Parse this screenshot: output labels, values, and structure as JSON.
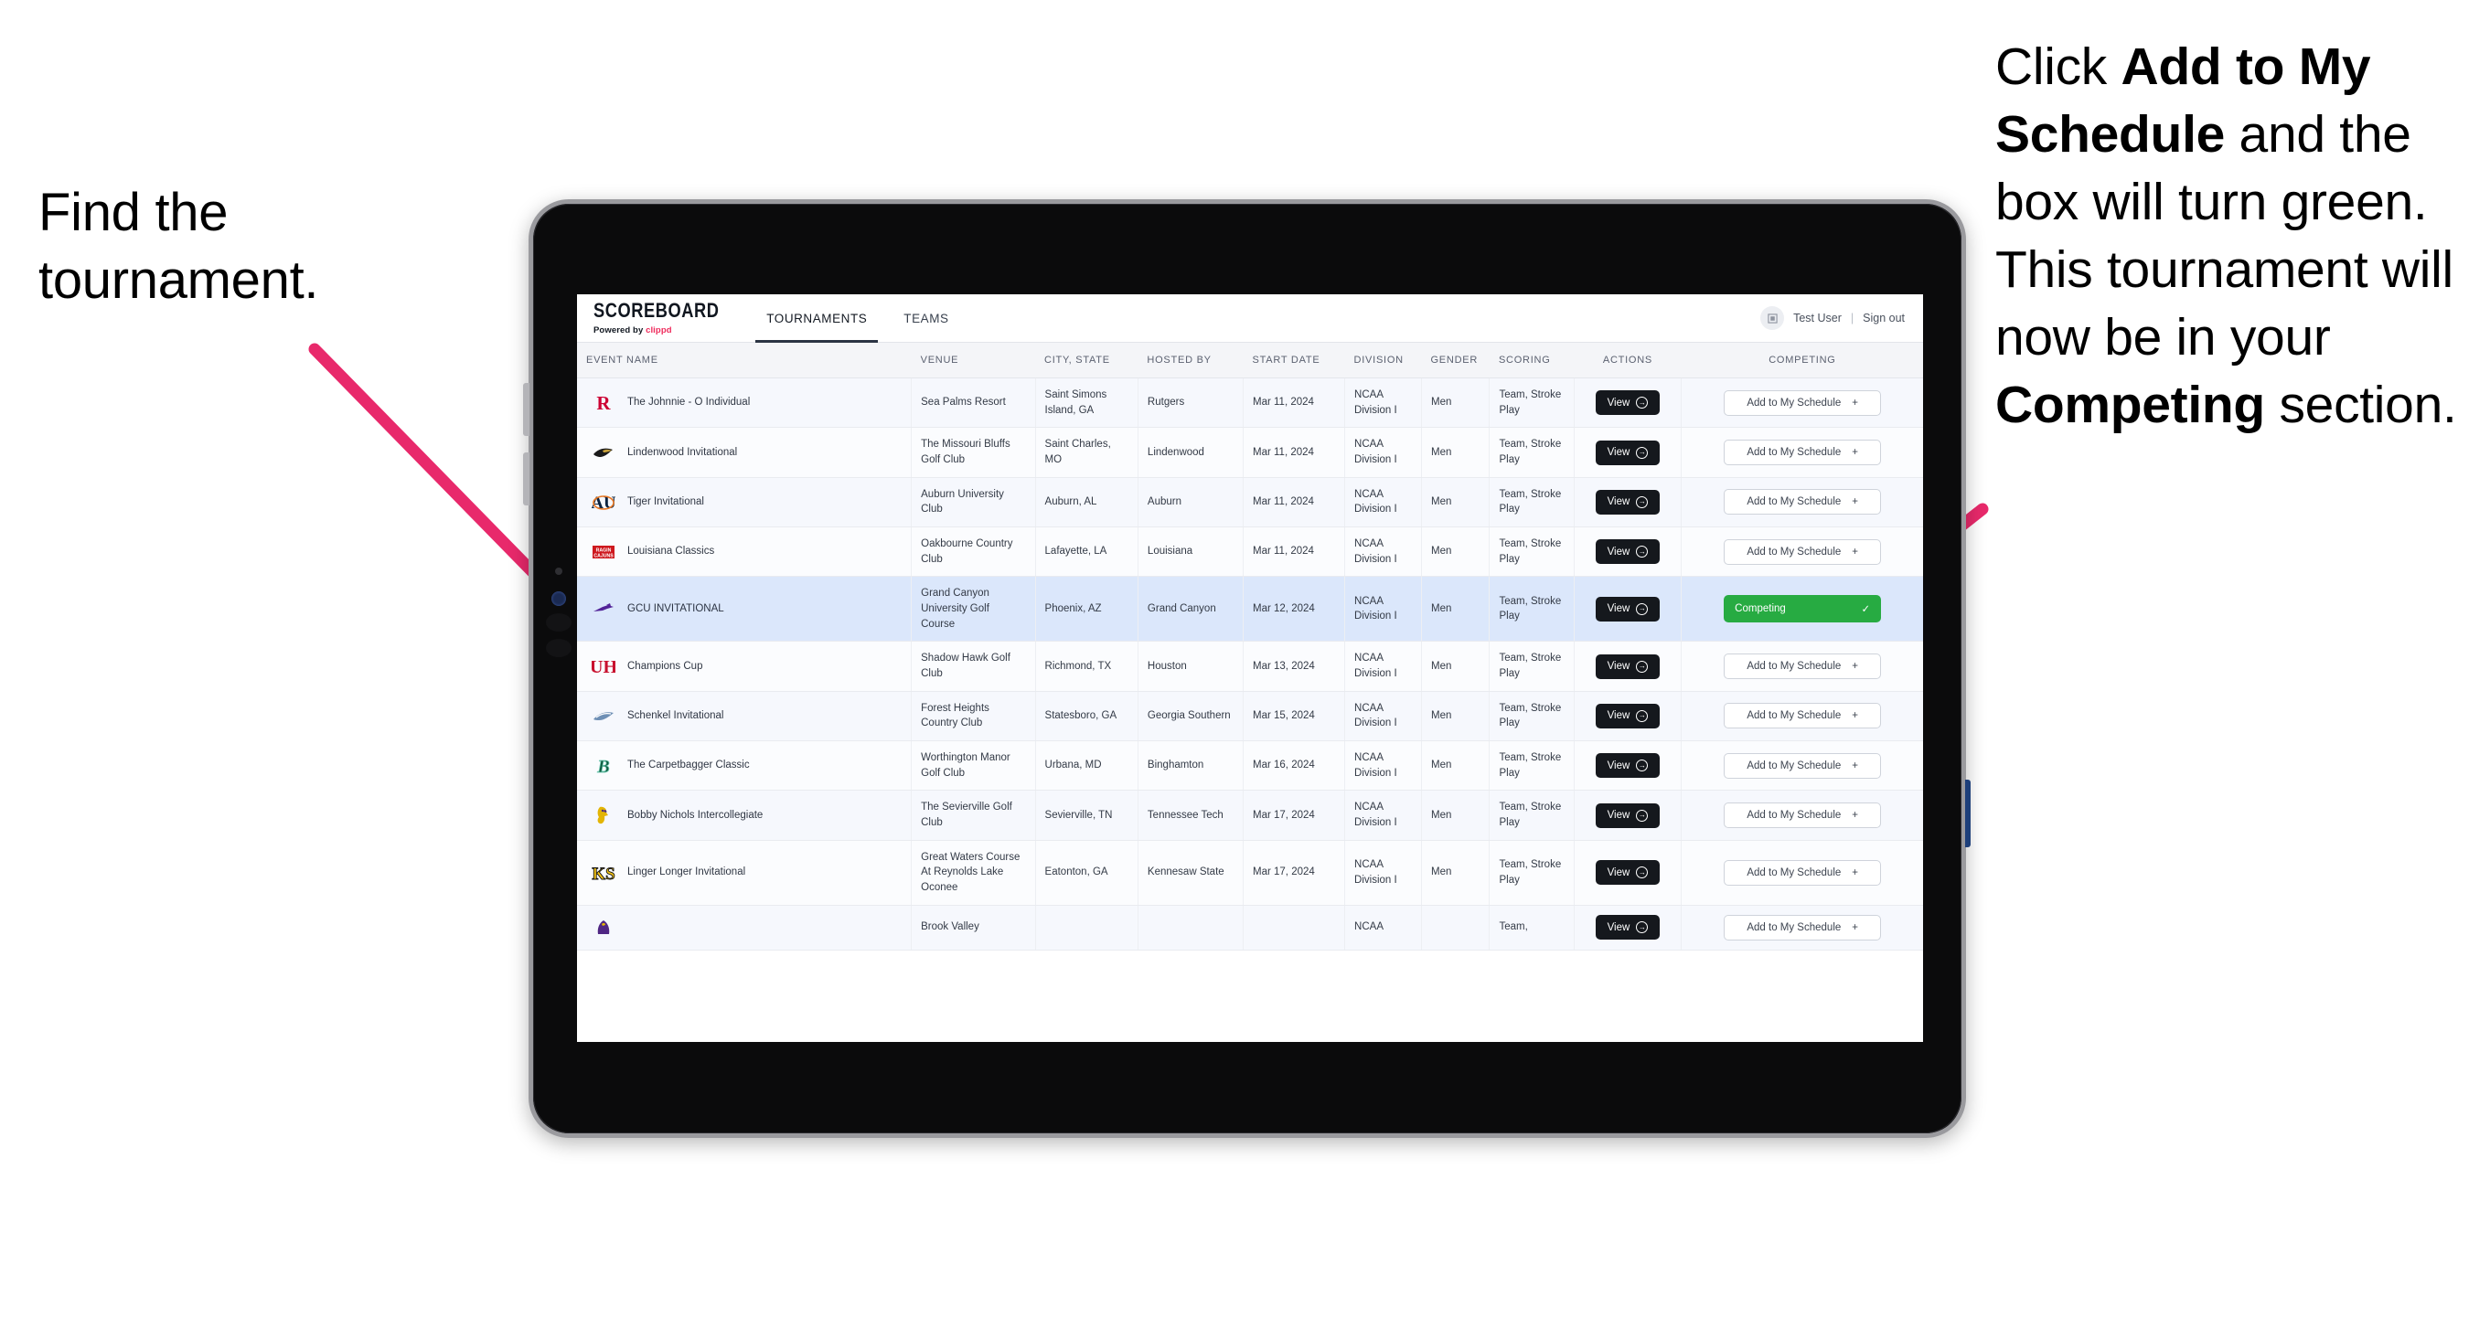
{
  "annotations": {
    "left": {
      "line1": "Find the",
      "line2": "tournament."
    },
    "right": {
      "seg1": "Click ",
      "bold1": "Add to My Schedule",
      "seg2": " and the box will turn green. This tournament will now be in your ",
      "bold2": "Competing",
      "seg3": " section."
    },
    "arrow_color": "#e8296b"
  },
  "app": {
    "brand": {
      "name": "SCOREBOARD",
      "powered_prefix": "Powered by ",
      "powered_brand": "clippd"
    },
    "tabs": [
      {
        "label": "TOURNAMENTS",
        "active": true
      },
      {
        "label": "TEAMS",
        "active": false
      }
    ],
    "user": {
      "name": "Test User",
      "separator": "|",
      "signout": "Sign out",
      "avatar_icon": "user-placeholder-icon"
    }
  },
  "table": {
    "columns": [
      "EVENT NAME",
      "VENUE",
      "CITY, STATE",
      "HOSTED BY",
      "START DATE",
      "DIVISION",
      "GENDER",
      "SCORING",
      "ACTIONS",
      "COMPETING"
    ],
    "action_labels": {
      "view": "View",
      "add": "Add to My Schedule",
      "add_glyph": "+",
      "competing": "Competing",
      "competing_glyph": "✓",
      "view_glyph": "→"
    },
    "rows": [
      {
        "logo": "rutgers-logo",
        "event": "The Johnnie - O Individual",
        "venue": "Sea Palms Resort",
        "city": "Saint Simons Island, GA",
        "host": "Rutgers",
        "date": "Mar 11, 2024",
        "division": "NCAA Division I",
        "gender": "Men",
        "scoring": "Team, Stroke Play",
        "competing": false
      },
      {
        "logo": "lindenwood-logo",
        "event": "Lindenwood Invitational",
        "venue": "The Missouri Bluffs Golf Club",
        "city": "Saint Charles, MO",
        "host": "Lindenwood",
        "date": "Mar 11, 2024",
        "division": "NCAA Division I",
        "gender": "Men",
        "scoring": "Team, Stroke Play",
        "competing": false
      },
      {
        "logo": "auburn-logo",
        "event": "Tiger Invitational",
        "venue": "Auburn University Club",
        "city": "Auburn, AL",
        "host": "Auburn",
        "date": "Mar 11, 2024",
        "division": "NCAA Division I",
        "gender": "Men",
        "scoring": "Team, Stroke Play",
        "competing": false
      },
      {
        "logo": "louisiana-logo",
        "event": "Louisiana Classics",
        "venue": "Oakbourne Country Club",
        "city": "Lafayette, LA",
        "host": "Louisiana",
        "date": "Mar 11, 2024",
        "division": "NCAA Division I",
        "gender": "Men",
        "scoring": "Team, Stroke Play",
        "competing": false
      },
      {
        "logo": "grandcanyon-logo",
        "event": "GCU INVITATIONAL",
        "venue": "Grand Canyon University Golf Course",
        "city": "Phoenix, AZ",
        "host": "Grand Canyon",
        "date": "Mar 12, 2024",
        "division": "NCAA Division I",
        "gender": "Men",
        "scoring": "Team, Stroke Play",
        "competing": true
      },
      {
        "logo": "houston-logo",
        "event": "Champions Cup",
        "venue": "Shadow Hawk Golf Club",
        "city": "Richmond, TX",
        "host": "Houston",
        "date": "Mar 13, 2024",
        "division": "NCAA Division I",
        "gender": "Men",
        "scoring": "Team, Stroke Play",
        "competing": false
      },
      {
        "logo": "georgiasouthern-logo",
        "event": "Schenkel Invitational",
        "venue": "Forest Heights Country Club",
        "city": "Statesboro, GA",
        "host": "Georgia Southern",
        "date": "Mar 15, 2024",
        "division": "NCAA Division I",
        "gender": "Men",
        "scoring": "Team, Stroke Play",
        "competing": false
      },
      {
        "logo": "binghamton-logo",
        "event": "The Carpetbagger Classic",
        "venue": "Worthington Manor Golf Club",
        "city": "Urbana, MD",
        "host": "Binghamton",
        "date": "Mar 16, 2024",
        "division": "NCAA Division I",
        "gender": "Men",
        "scoring": "Team, Stroke Play",
        "competing": false
      },
      {
        "logo": "tennesseetech-logo",
        "event": "Bobby Nichols Intercollegiate",
        "venue": "The Sevierville Golf Club",
        "city": "Sevierville, TN",
        "host": "Tennessee Tech",
        "date": "Mar 17, 2024",
        "division": "NCAA Division I",
        "gender": "Men",
        "scoring": "Team, Stroke Play",
        "competing": false
      },
      {
        "logo": "kennesaw-logo",
        "event": "Linger Longer Invitational",
        "venue": "Great Waters Course At Reynolds Lake Oconee",
        "city": "Eatonton, GA",
        "host": "Kennesaw State",
        "date": "Mar 17, 2024",
        "division": "NCAA Division I",
        "gender": "Men",
        "scoring": "Team, Stroke Play",
        "competing": false
      },
      {
        "logo": "eastcarolina-logo",
        "event": "",
        "venue": "Brook Valley",
        "city": "",
        "host": "",
        "date": "",
        "division": "NCAA",
        "gender": "",
        "scoring": "Team,",
        "competing": false,
        "partial": true
      }
    ]
  }
}
